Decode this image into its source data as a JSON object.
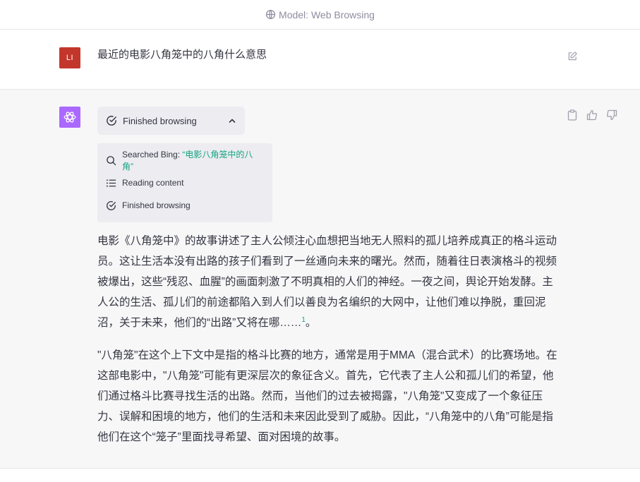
{
  "header": {
    "model_label": "Model: Web Browsing"
  },
  "user_message": {
    "avatar_initials": "LI",
    "text": "最近的电影八角笼中的八角什么意思"
  },
  "assistant": {
    "browse_toggle_label": "Finished browsing",
    "steps": {
      "search_prefix": "Searched Bing: ",
      "search_query": "“电影八角笼中的八角”",
      "reading": "Reading content",
      "finished": "Finished browsing"
    },
    "paragraph1": "电影《八角笼中》的故事讲述了主人公倾注心血想把当地无人照料的孤儿培养成真正的格斗运动员。这让生活本没有出路的孩子们看到了一丝通向未来的曙光。然而，随着往日表演格斗的视频被爆出，这些“残忍、血腥”的画面刺激了不明真相的人们的神经。一夜之间，舆论开始发酵。主人公的生活、孤儿们的前途都陷入到人们以善良为名编织的大网中，让他们难以挣脱，重回泥沼，关于未来，他们的“出路”又将在哪……",
    "citation": "1",
    "paragraph1_end": "。",
    "paragraph2": "\"八角笼\"在这个上下文中是指的格斗比赛的地方，通常是用于MMA（混合武术）的比赛场地。在这部电影中，\"八角笼\"可能有更深层次的象征含义。首先，它代表了主人公和孤儿们的希望，他们通过格斗比赛寻找生活的出路。然而，当他们的过去被揭露，\"八角笼\"又变成了一个象征压力、误解和困境的地方，他们的生活和未来因此受到了威胁。因此，“八角笼中的八角”可能是指他们在这个“笼子”里面找寻希望、面对困境的故事。"
  },
  "colors": {
    "user_avatar": "#c2362b",
    "bot_avatar": "#ab68ff",
    "accent": "#10a37f"
  },
  "icons": [
    "web-browsing-icon",
    "edit-icon",
    "openai-logo-icon",
    "clipboard-icon",
    "thumbs-up-icon",
    "thumbs-down-icon",
    "check-circle-icon",
    "chevron-up-icon",
    "search-icon",
    "list-icon"
  ]
}
